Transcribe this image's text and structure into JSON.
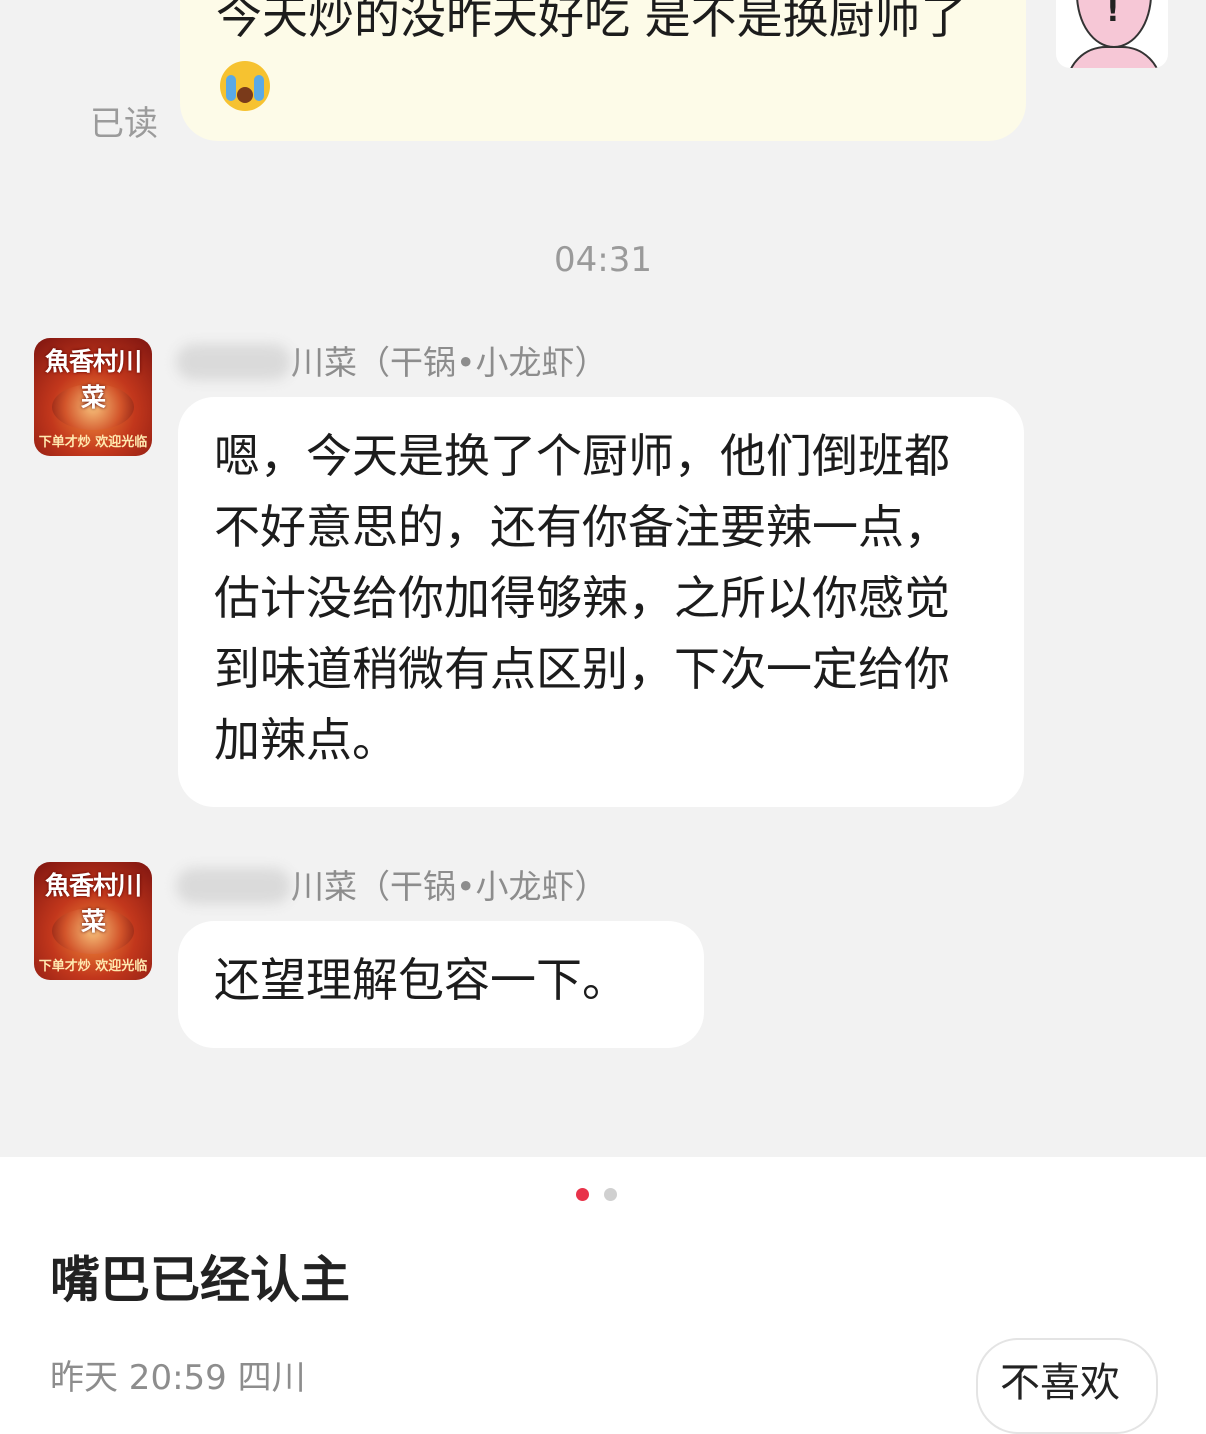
{
  "chat": {
    "outgoing_message": "今天炒的没昨天好吃  是不是换厨师了",
    "read_status": "已读",
    "timestamp": "04:31",
    "shop": {
      "logo_text": "魚香村川菜",
      "slogan": "下单才炒 欢迎光临"
    },
    "messages": [
      {
        "sender": "川菜（干锅•小龙虾）",
        "text": "嗯，今天是换了个厨师，他们倒班都不好意思的，还有你备注要辣一点，估计没给你加得够辣，之所以你感觉到味道稍微有点区别，下次一定给你加辣点。"
      },
      {
        "sender": "川菜（干锅•小龙虾）",
        "text": "还望理解包容一下。"
      }
    ]
  },
  "post": {
    "title": "嘴巴已经认主",
    "meta": "昨天 20:59 四川",
    "dislike_label": "不喜欢"
  },
  "colors": {
    "chat_background": "#f2f2f2",
    "outgoing_bubble": "#fdfbe8",
    "incoming_bubble": "#ffffff",
    "active_dot": "#e8334a"
  },
  "icons": [
    "crying-emoji-icon",
    "user-avatar-icon",
    "shop-avatar-icon",
    "dislike-icon"
  ]
}
